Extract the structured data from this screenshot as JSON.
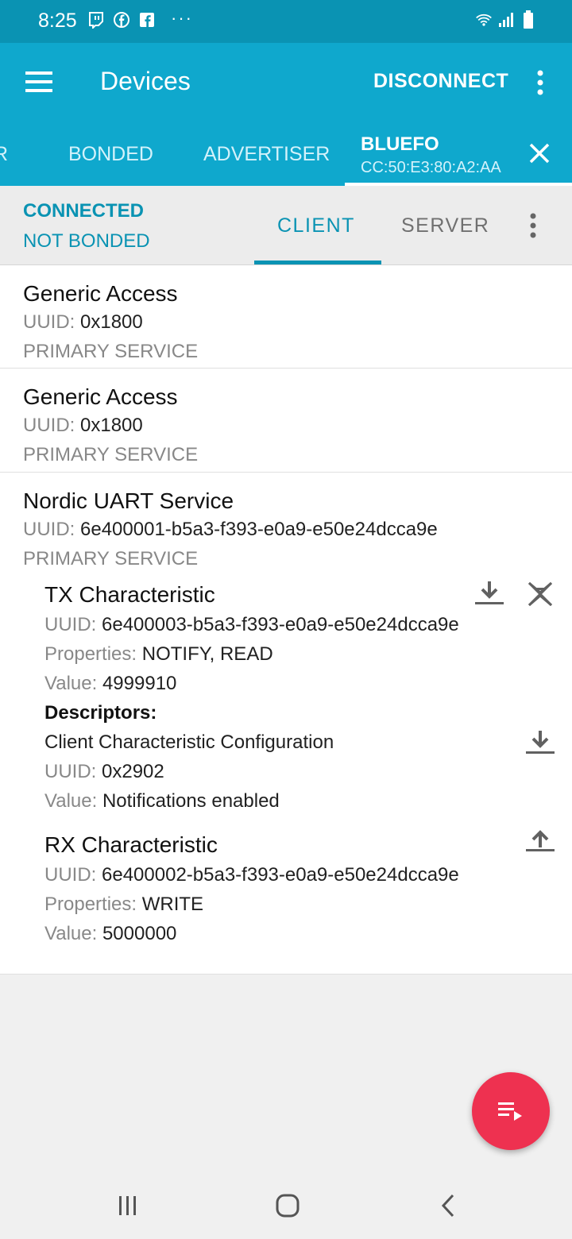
{
  "status_bar": {
    "time": "8:25",
    "left_icons": [
      "twitch-icon",
      "facebook-circle-icon",
      "facebook-square-icon"
    ],
    "more": "···",
    "right_icons": [
      "wifi-icon",
      "signal-icon",
      "battery-icon"
    ]
  },
  "app_bar": {
    "title": "Devices",
    "disconnect_label": "DISCONNECT"
  },
  "tabs": {
    "partial": "R",
    "bonded": "BONDED",
    "advertiser": "ADVERTISER",
    "device_name": "BLUEFO",
    "device_address": "CC:50:E3:80:A2:AA"
  },
  "connection": {
    "state": "CONNECTED",
    "bond_state": "NOT BONDED",
    "client_tab": "CLIENT",
    "server_tab": "SERVER"
  },
  "labels": {
    "uuid": "UUID:",
    "properties": "Properties:",
    "value": "Value:",
    "descriptors": "Descriptors:"
  },
  "services": [
    {
      "name": "Generic Access",
      "uuid": "0x1800",
      "type": "PRIMARY SERVICE"
    },
    {
      "name": "Generic Access",
      "uuid": "0x1800",
      "type": "PRIMARY SERVICE"
    },
    {
      "name": "Nordic UART Service",
      "uuid": "6e400001-b5a3-f393-e0a9-e50e24dcca9e",
      "type": "PRIMARY SERVICE",
      "characteristics": [
        {
          "name": "TX Characteristic",
          "uuid": "6e400003-b5a3-f393-e0a9-e50e24dcca9e",
          "properties": "NOTIFY, READ",
          "value": "4999910",
          "descriptor": {
            "name": "Client Characteristic Configuration",
            "uuid": "0x2902",
            "value": "Notifications enabled"
          }
        },
        {
          "name": "RX Characteristic",
          "uuid": "6e400002-b5a3-f393-e0a9-e50e24dcca9e",
          "properties": "WRITE",
          "value": "5000000"
        }
      ]
    }
  ],
  "colors": {
    "status_bar": "#0a93b3",
    "app_bar": "#0fa8cd",
    "accent": "#0a93b3",
    "fab": "#ee3150"
  }
}
